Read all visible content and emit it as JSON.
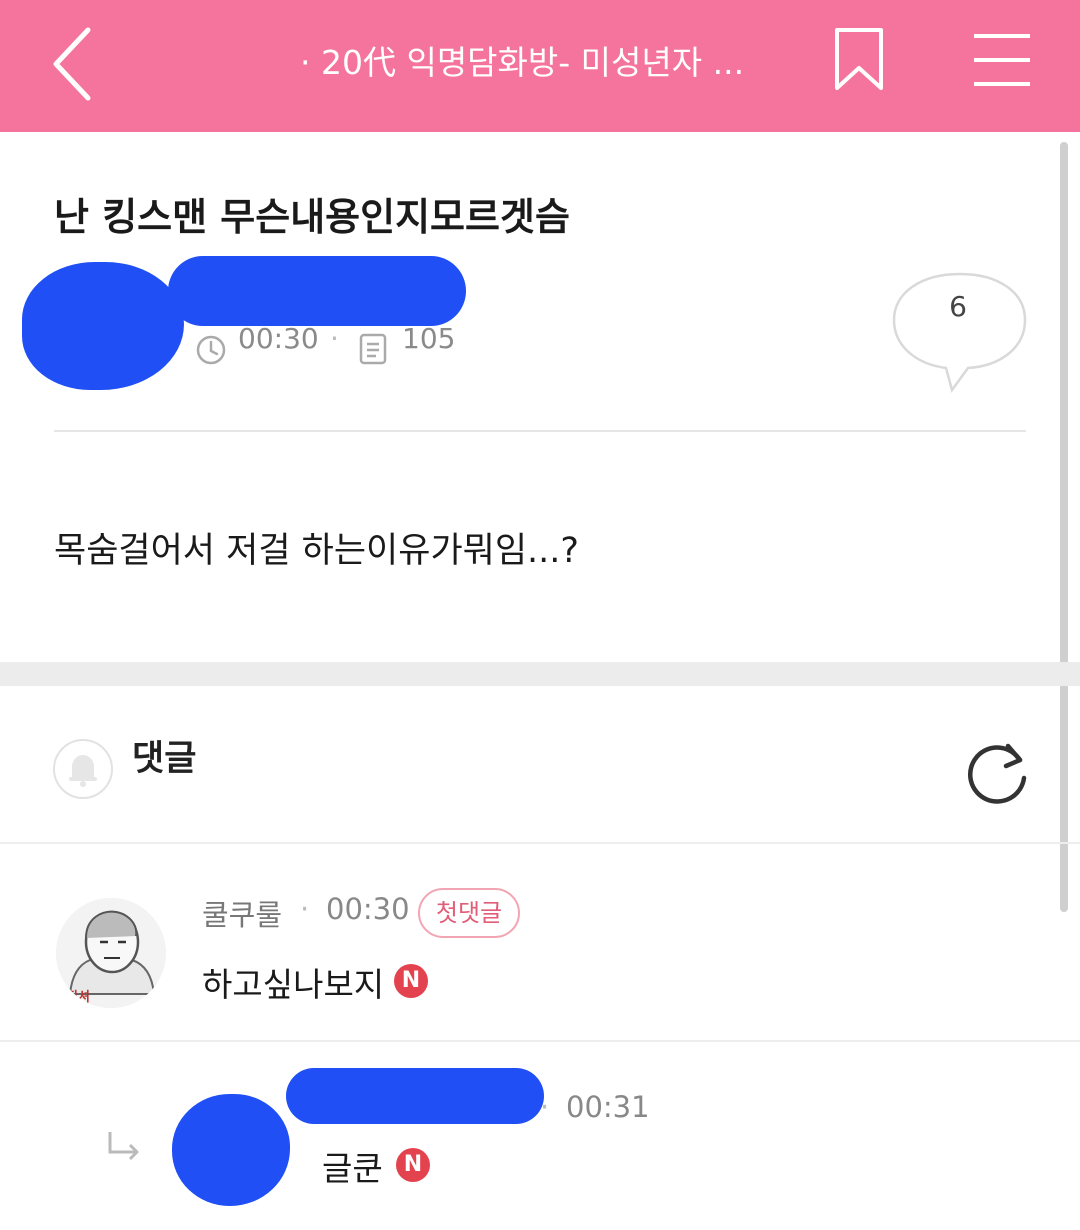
{
  "topbar": {
    "title": "· 20代 익명담화방- 미성년자 ...",
    "bg_color": "#f4749e",
    "back_icon": "chevron-left-icon",
    "bookmark_icon": "bookmark-icon",
    "menu_icon": "hamburger-menu-icon"
  },
  "post": {
    "title": "난 킹스맨 무슨내용인지모르겟슴",
    "time": "00:30",
    "views": "105",
    "comment_count": "6",
    "body": "목숨걸어서 저걸 하는이유가뭐임...?"
  },
  "comments_section": {
    "label": "댓글",
    "bell_icon": "bell-icon",
    "refresh_icon": "refresh-icon"
  },
  "comments": [
    {
      "author": "쿨쿠룰",
      "time": "00:30",
      "badge": "첫댓글",
      "text": "하고싶나보지",
      "new_badge": "N",
      "avatar_caption": "픽셔"
    },
    {
      "time": "00:31",
      "text": "글쿤",
      "new_badge": "N"
    }
  ],
  "colors": {
    "accent": "#f4749e",
    "redaction": "#1f4ff5",
    "new_badge": "#e3424f"
  }
}
